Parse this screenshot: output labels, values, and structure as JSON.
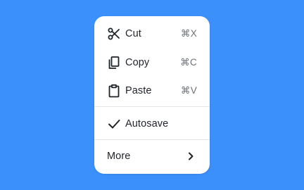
{
  "menu": {
    "items": [
      {
        "label": "Cut",
        "shortcut": "⌘X",
        "icon": "scissors-icon"
      },
      {
        "label": "Copy",
        "shortcut": "⌘C",
        "icon": "copy-icon"
      },
      {
        "label": "Paste",
        "shortcut": "⌘V",
        "icon": "clipboard-icon"
      }
    ],
    "toggle": {
      "label": "Autosave",
      "checked": true,
      "icon": "checkmark-icon"
    },
    "submenu": {
      "label": "More",
      "icon": "chevron-right-icon"
    }
  },
  "colors": {
    "background": "#3b90fb",
    "panel": "#ffffff",
    "text": "#1f2328",
    "shortcut": "#6b7075",
    "divider": "#e3e5e8"
  }
}
